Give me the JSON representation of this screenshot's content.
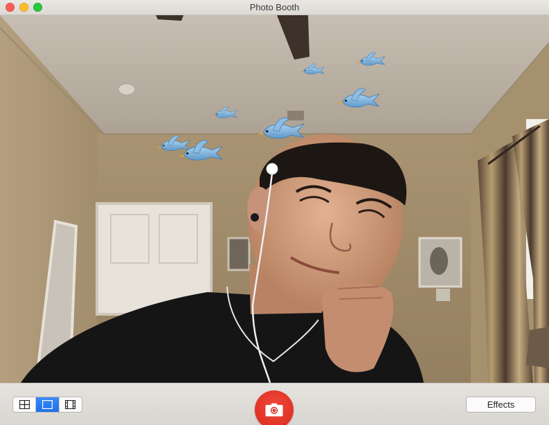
{
  "window": {
    "title": "Photo Booth"
  },
  "toolbar": {
    "view_modes": [
      {
        "icon": "four-up-grid-icon",
        "selected": false
      },
      {
        "icon": "single-photo-icon",
        "selected": true
      },
      {
        "icon": "filmstrip-video-icon",
        "selected": false
      }
    ],
    "shutter_icon": "camera-icon",
    "effects_label": "Effects"
  },
  "preview": {
    "effect_overlay_icon": "flying-bird-icon",
    "bird_count": 7
  },
  "colors": {
    "shutter": "#e0372a",
    "selected_mode": "#2a7bf2",
    "bird": "#7db3de",
    "close": "#fd5f57",
    "minimize": "#febc2e",
    "zoom": "#28c840"
  }
}
